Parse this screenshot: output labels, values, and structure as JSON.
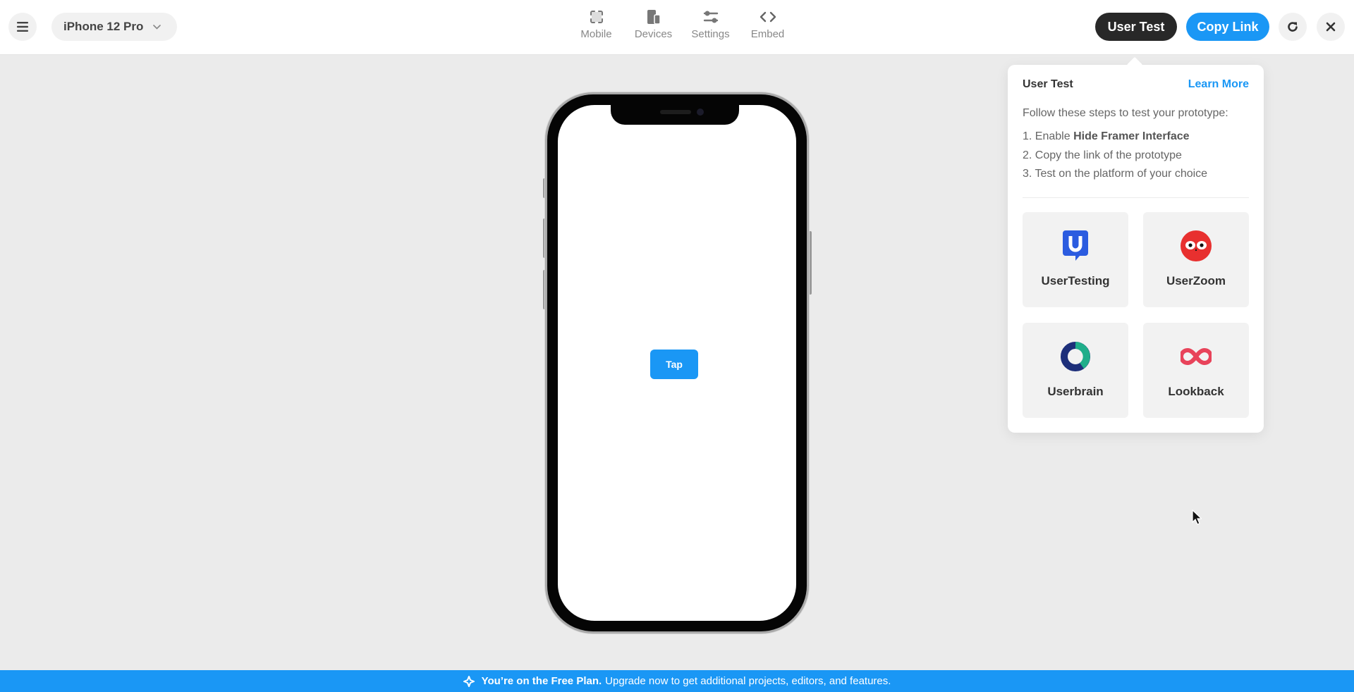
{
  "topbar": {
    "menu_icon": "hamburger-menu-icon",
    "device_select": {
      "value": "iPhone 12 Pro",
      "icon": "chevron-down-icon"
    },
    "nav": [
      {
        "label": "Mobile",
        "icon": "fullscreen-frame-icon"
      },
      {
        "label": "Devices",
        "icon": "devices-icon"
      },
      {
        "label": "Settings",
        "icon": "sliders-icon"
      },
      {
        "label": "Embed",
        "icon": "code-brackets-icon"
      }
    ],
    "user_test_label": "User Test",
    "copy_link_label": "Copy Link",
    "refresh_icon": "refresh-icon",
    "close_icon": "close-icon"
  },
  "popover": {
    "title": "User Test",
    "learn_more": "Learn More",
    "intro": "Follow these steps to test your prototype:",
    "steps": [
      {
        "prefix": "1. Enable ",
        "bold": "Hide Framer Interface"
      },
      {
        "prefix": "2. Copy the link of the prototype",
        "bold": ""
      },
      {
        "prefix": "3. Test on the platform of your choice",
        "bold": ""
      }
    ],
    "platforms": [
      {
        "name": "UserTesting",
        "icon": "usertesting-logo-icon",
        "color": "#2c5ce0"
      },
      {
        "name": "UserZoom",
        "icon": "userzoom-owl-logo-icon",
        "color": "#e8302f"
      },
      {
        "name": "Userbrain",
        "icon": "userbrain-ring-logo-icon",
        "color": "#1fae8a"
      },
      {
        "name": "Lookback",
        "icon": "lookback-infinity-logo-icon",
        "color": "#e8435a"
      }
    ]
  },
  "prototype": {
    "device": "iPhone 12 Pro",
    "tap_button_label": "Tap"
  },
  "banner": {
    "icon": "sparkle-icon",
    "bold": "You’re on the Free Plan.",
    "text": "Upgrade now to get additional projects, editors, and features."
  },
  "colors": {
    "accent": "#1a97f5",
    "dark_button": "#282828",
    "canvas": "#ebebeb"
  }
}
